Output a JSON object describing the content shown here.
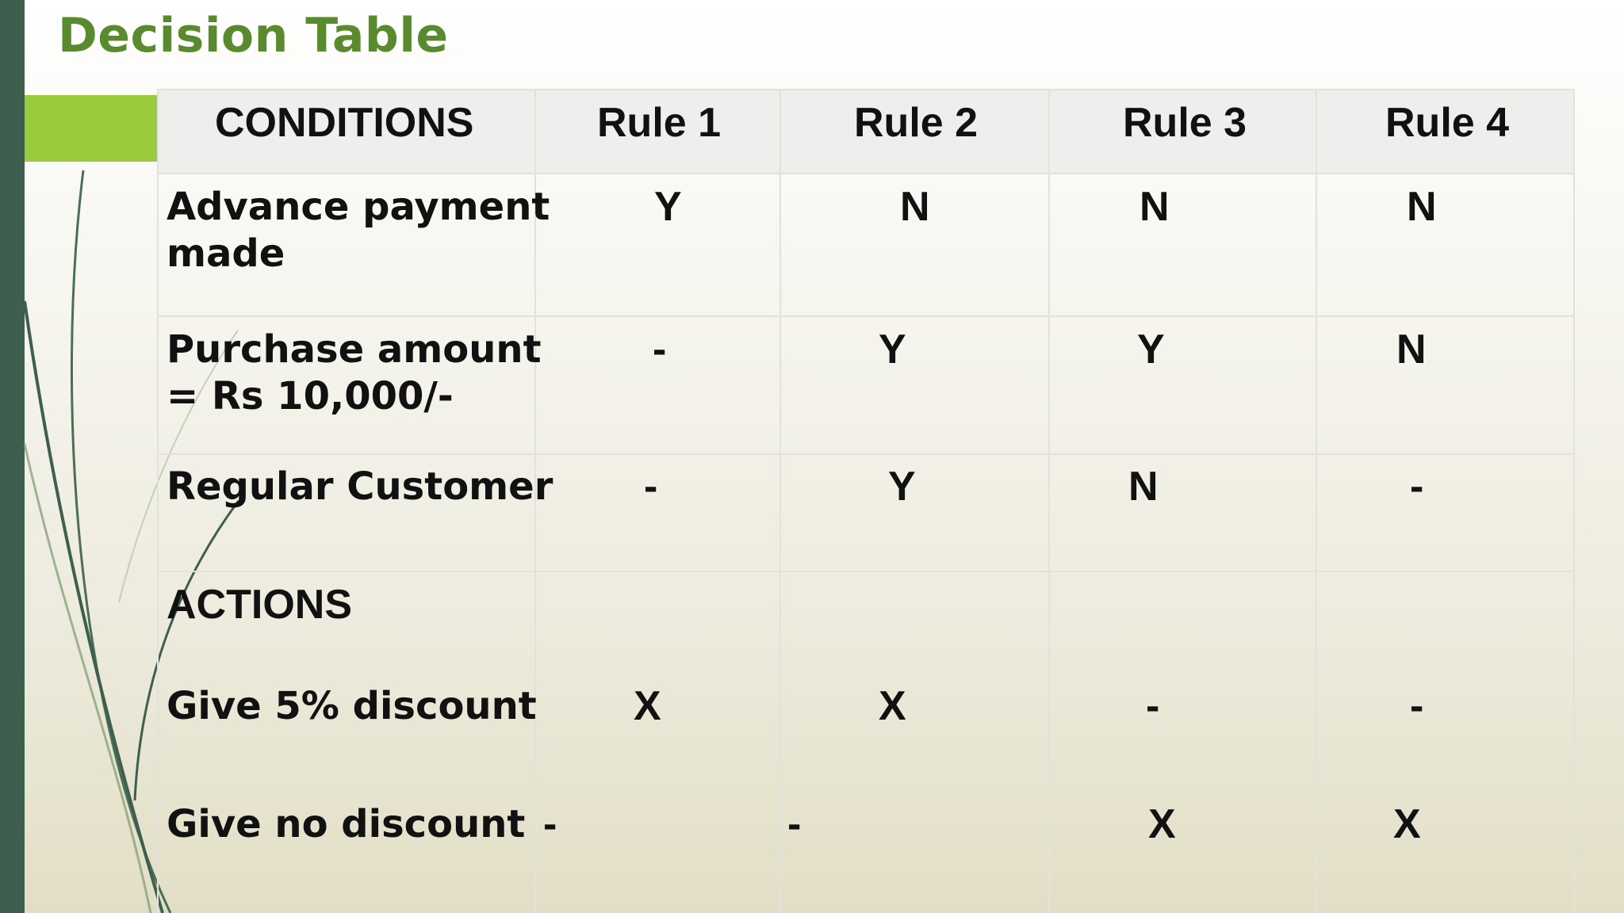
{
  "title": "Decision Table",
  "columns": [
    "CONDITIONS",
    "Rule 1",
    "Rule 2",
    "Rule 3",
    "Rule 4"
  ],
  "conditions": [
    {
      "lines": [
        "Advance payment",
        "made"
      ],
      "values": [
        "Y",
        "N",
        "N",
        "N"
      ]
    },
    {
      "lines": [
        "Purchase amount",
        "= Rs 10,000/-"
      ],
      "values": [
        "-",
        "Y",
        "Y",
        "N"
      ]
    },
    {
      "lines": [
        "Regular Customer"
      ],
      "values": [
        "-",
        "Y",
        "N",
        "-"
      ]
    }
  ],
  "actions_label": "ACTIONS",
  "actions": [
    {
      "label": "Give 5% discount",
      "values": [
        "X",
        "X",
        "-",
        "-"
      ]
    },
    {
      "label": "Give no discount",
      "values": [
        "-",
        "-",
        "X",
        "X"
      ]
    }
  ],
  "colors": {
    "title": "#5a8a2e",
    "left_bar": "#3f5f4e",
    "accent_bar": "#9acb3c",
    "header_bg": "#eeeeed"
  }
}
